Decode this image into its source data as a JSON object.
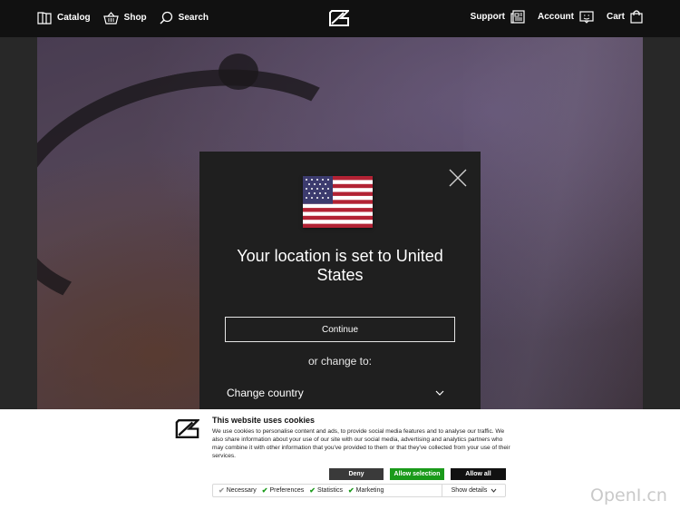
{
  "nav": {
    "left": [
      {
        "label": "Catalog",
        "icon": "book-icon"
      },
      {
        "label": "Shop",
        "icon": "basket-icon"
      },
      {
        "label": "Search",
        "icon": "search-icon"
      }
    ],
    "right": [
      {
        "label": "Support",
        "icon": "newspaper-icon"
      },
      {
        "label": "Account",
        "icon": "account-icon"
      },
      {
        "label": "Cart",
        "icon": "bag-icon"
      }
    ]
  },
  "modal": {
    "title": "Your location is set to United States",
    "continue_label": "Continue",
    "or_change": "or change to:",
    "change_country": "Change country"
  },
  "cookie": {
    "title": "This website uses cookies",
    "text": "We use cookies to personalise content and ads, to provide social media features and to analyse our traffic. We also share information about your use of our site with our social media, advertising and analytics partners who may combine it with other information that you've provided to them or that they've collected from your use of their services.",
    "deny": "Deny",
    "allow_selection": "Allow selection",
    "allow_all": "Allow all",
    "options": [
      {
        "label": "Necessary",
        "checked": true,
        "disabled": true
      },
      {
        "label": "Preferences",
        "checked": true
      },
      {
        "label": "Statistics",
        "checked": true
      },
      {
        "label": "Marketing",
        "checked": true
      }
    ],
    "show_details": "Show details"
  },
  "watermark": "OpenI.cn",
  "colors": {
    "topbar": "#111111",
    "modal": "#1f1f1f",
    "allow_selection": "#1a9a1a"
  }
}
